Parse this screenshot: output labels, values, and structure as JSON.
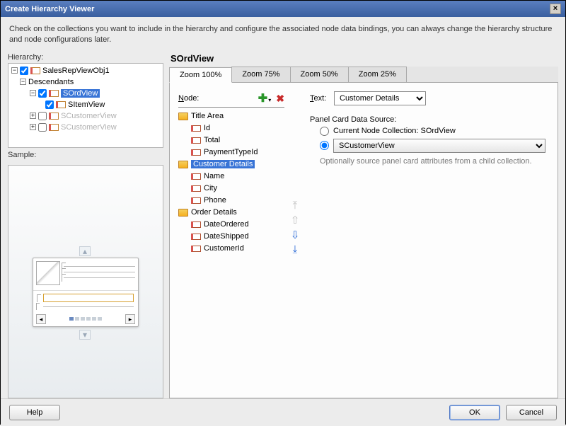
{
  "dialog": {
    "title": "Create Hierarchy Viewer"
  },
  "instructions": "Check on the collections you want to include in the hierarchy and configure the associated node data bindings, you can always change the hierarchy structure and node configurations later.",
  "hierarchy": {
    "label": "Hierarchy:",
    "root": "SalesRepViewObj1",
    "desc": "Descendants",
    "items": [
      "SOrdView",
      "SItemView",
      "SCustomerView",
      "SCustomerView"
    ]
  },
  "sample": {
    "label": "Sample:"
  },
  "right": {
    "title": "SOrdView",
    "tabs": [
      "Zoom 100%",
      "Zoom 75%",
      "Zoom 50%",
      "Zoom 25%"
    ],
    "nodeLabel": "Node:",
    "groups": [
      {
        "name": "Title Area",
        "fields": [
          "Id",
          "Total",
          "PaymentTypeId"
        ]
      },
      {
        "name": "Customer Details",
        "fields": [
          "Name",
          "City",
          "Phone"
        ]
      },
      {
        "name": "Order Details",
        "fields": [
          "DateOrdered",
          "DateShipped",
          "CustomerId"
        ]
      }
    ],
    "textLabel": "Text:",
    "textValue": "Customer Details",
    "panelLabel": "Panel Card Data Source:",
    "radio1": "Current Node Collection: SOrdView",
    "radio2": "SCustomerView",
    "hint": "Optionally source panel card attributes from a child collection."
  },
  "footer": {
    "help": "Help",
    "ok": "OK",
    "cancel": "Cancel"
  }
}
